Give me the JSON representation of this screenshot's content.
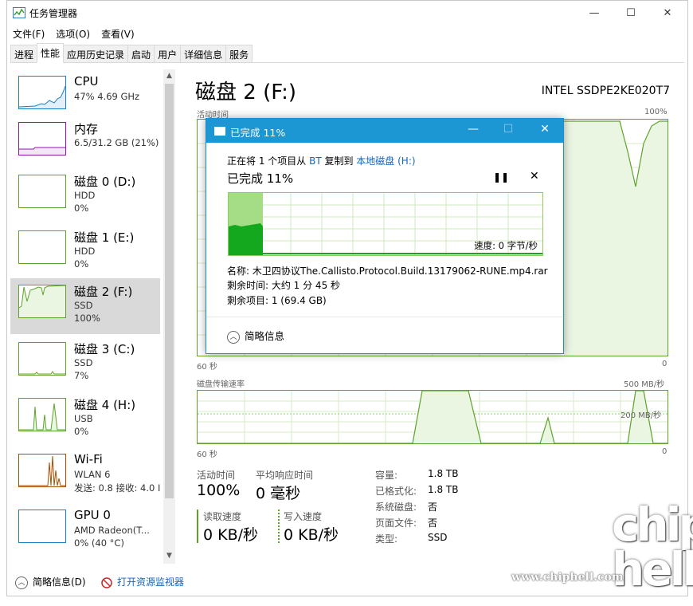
{
  "app": {
    "title": "任务管理器",
    "menu": [
      "文件(F)",
      "选项(O)",
      "查看(V)"
    ],
    "tabs": [
      "进程",
      "性能",
      "应用历史记录",
      "启动",
      "用户",
      "详细信息",
      "服务"
    ],
    "active_tab": "性能"
  },
  "sidebar": {
    "items": [
      {
        "name": "CPU",
        "sub1": "47% 4.69 GHz",
        "sub2": ""
      },
      {
        "name": "内存",
        "sub1": "6.5/31.2 GB (21%)",
        "sub2": ""
      },
      {
        "name": "磁盘 0 (D:)",
        "sub1": "HDD",
        "sub2": "0%"
      },
      {
        "name": "磁盘 1 (E:)",
        "sub1": "HDD",
        "sub2": "0%"
      },
      {
        "name": "磁盘 2 (F:)",
        "sub1": "SSD",
        "sub2": "100%"
      },
      {
        "name": "磁盘 3 (C:)",
        "sub1": "SSD",
        "sub2": "7%"
      },
      {
        "name": "磁盘 4 (H:)",
        "sub1": "USB",
        "sub2": "0%"
      },
      {
        "name": "Wi-Fi",
        "sub1": "WLAN 6",
        "sub2": "发送: 0.8 接收: 4.0 I"
      },
      {
        "name": "GPU 0",
        "sub1": "AMD Radeon(T...",
        "sub2": "0% (40 °C)"
      }
    ],
    "selected_index": 4
  },
  "main": {
    "title": "磁盘 2 (F:)",
    "model": "INTEL SSDPE2KE020T7",
    "active_time_label": "活动时间",
    "active_time_max": "100%",
    "graph1_left": "60 秒",
    "graph1_right": "0",
    "transfer_label": "磁盘传输速率",
    "transfer_max": "500 MB/秒",
    "transfer_mid": "200 MB/秒",
    "graph2_left": "60 秒",
    "graph2_right": "0",
    "stats": {
      "active_time_label": "活动时间",
      "active_time_value": "100%",
      "resp_label": "平均响应时间",
      "resp_value": "0 毫秒",
      "read_label": "读取速度",
      "read_value": "0 KB/秒",
      "write_label": "写入速度",
      "write_value": "0 KB/秒"
    },
    "right_stats": [
      {
        "label": "容量:",
        "value": "1.8 TB"
      },
      {
        "label": "已格式化:",
        "value": "1.8 TB"
      },
      {
        "label": "系统磁盘:",
        "value": "否"
      },
      {
        "label": "页面文件:",
        "value": "否"
      },
      {
        "label": "类型:",
        "value": "SSD"
      }
    ]
  },
  "footer": {
    "summary": "简略信息(D)",
    "monitor": "打开资源监视器"
  },
  "dialog": {
    "title": "已完成 11%",
    "line_prefix": "正在将 1 个项目从 ",
    "source": "BT",
    "line_mid": " 复制到 ",
    "dest": "本地磁盘 (H:)",
    "percent": "已完成 11%",
    "progress": 0.11,
    "speed": "速度: 0 字节/秒",
    "name_line": "名称: 木卫四协议The.Callisto.Protocol.Build.13179062-RUNE.mp4.rar",
    "remaining_time": "剩余时间: 大约 1 分 45 秒",
    "remaining_items": "剩余项目: 1 (69.4 GB)",
    "summary": "简略信息"
  },
  "watermark": {
    "url": "www.chiphell.com",
    "logo": "chip hell"
  }
}
